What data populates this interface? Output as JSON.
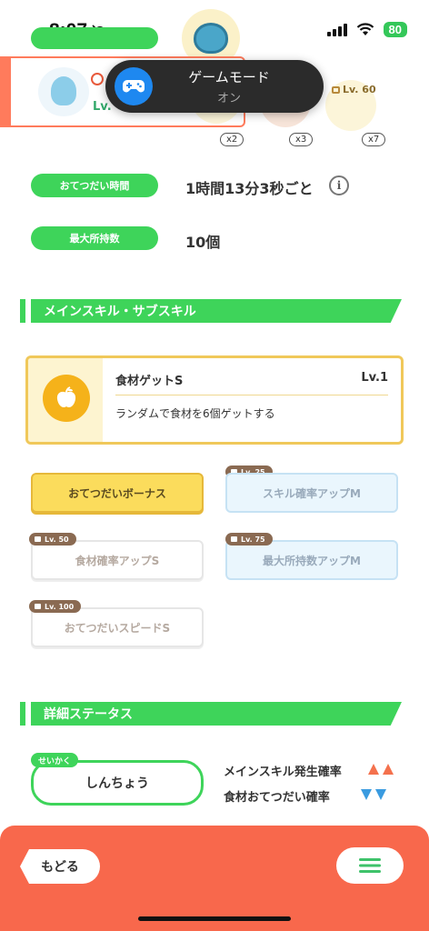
{
  "status_bar": {
    "time": "8:07",
    "battery": "80"
  },
  "game_mode": {
    "title": "ゲームモード",
    "subtitle": "オン"
  },
  "pokemon": {
    "level_prefix": "Lv."
  },
  "ingredients": {
    "counts": [
      "x2",
      "x3",
      "x7"
    ],
    "locked_level": "Lv. 60"
  },
  "info": {
    "help_time_label": "おてつだい時間",
    "help_time_value": "1時間13分3秒ごと",
    "max_carry_label": "最大所持数",
    "max_carry_value": "10個"
  },
  "sections": {
    "skills": "メインスキル・サブスキル",
    "details": "詳細ステータス"
  },
  "main_skill": {
    "name": "食材ゲットS",
    "level": "Lv.1",
    "description": "ランダムで食材を6個ゲットする"
  },
  "sub_skills": [
    {
      "label": "おてつだいボーナス",
      "lock": ""
    },
    {
      "label": "スキル確率アップM",
      "lock": "Lv. 25"
    },
    {
      "label": "食材確率アップS",
      "lock": "Lv. 50"
    },
    {
      "label": "最大所持数アップM",
      "lock": "Lv. 75"
    },
    {
      "label": "おてつだいスピードS",
      "lock": "Lv. 100"
    }
  ],
  "nature": {
    "tag": "せいかく",
    "name": "しんちょう",
    "up_stat": "メインスキル発生確率",
    "down_stat": "食材おてつだい確率",
    "colors": {
      "up": "#f4714d",
      "down": "#3a9be0"
    }
  },
  "bottom": {
    "back_label": "もどる"
  }
}
